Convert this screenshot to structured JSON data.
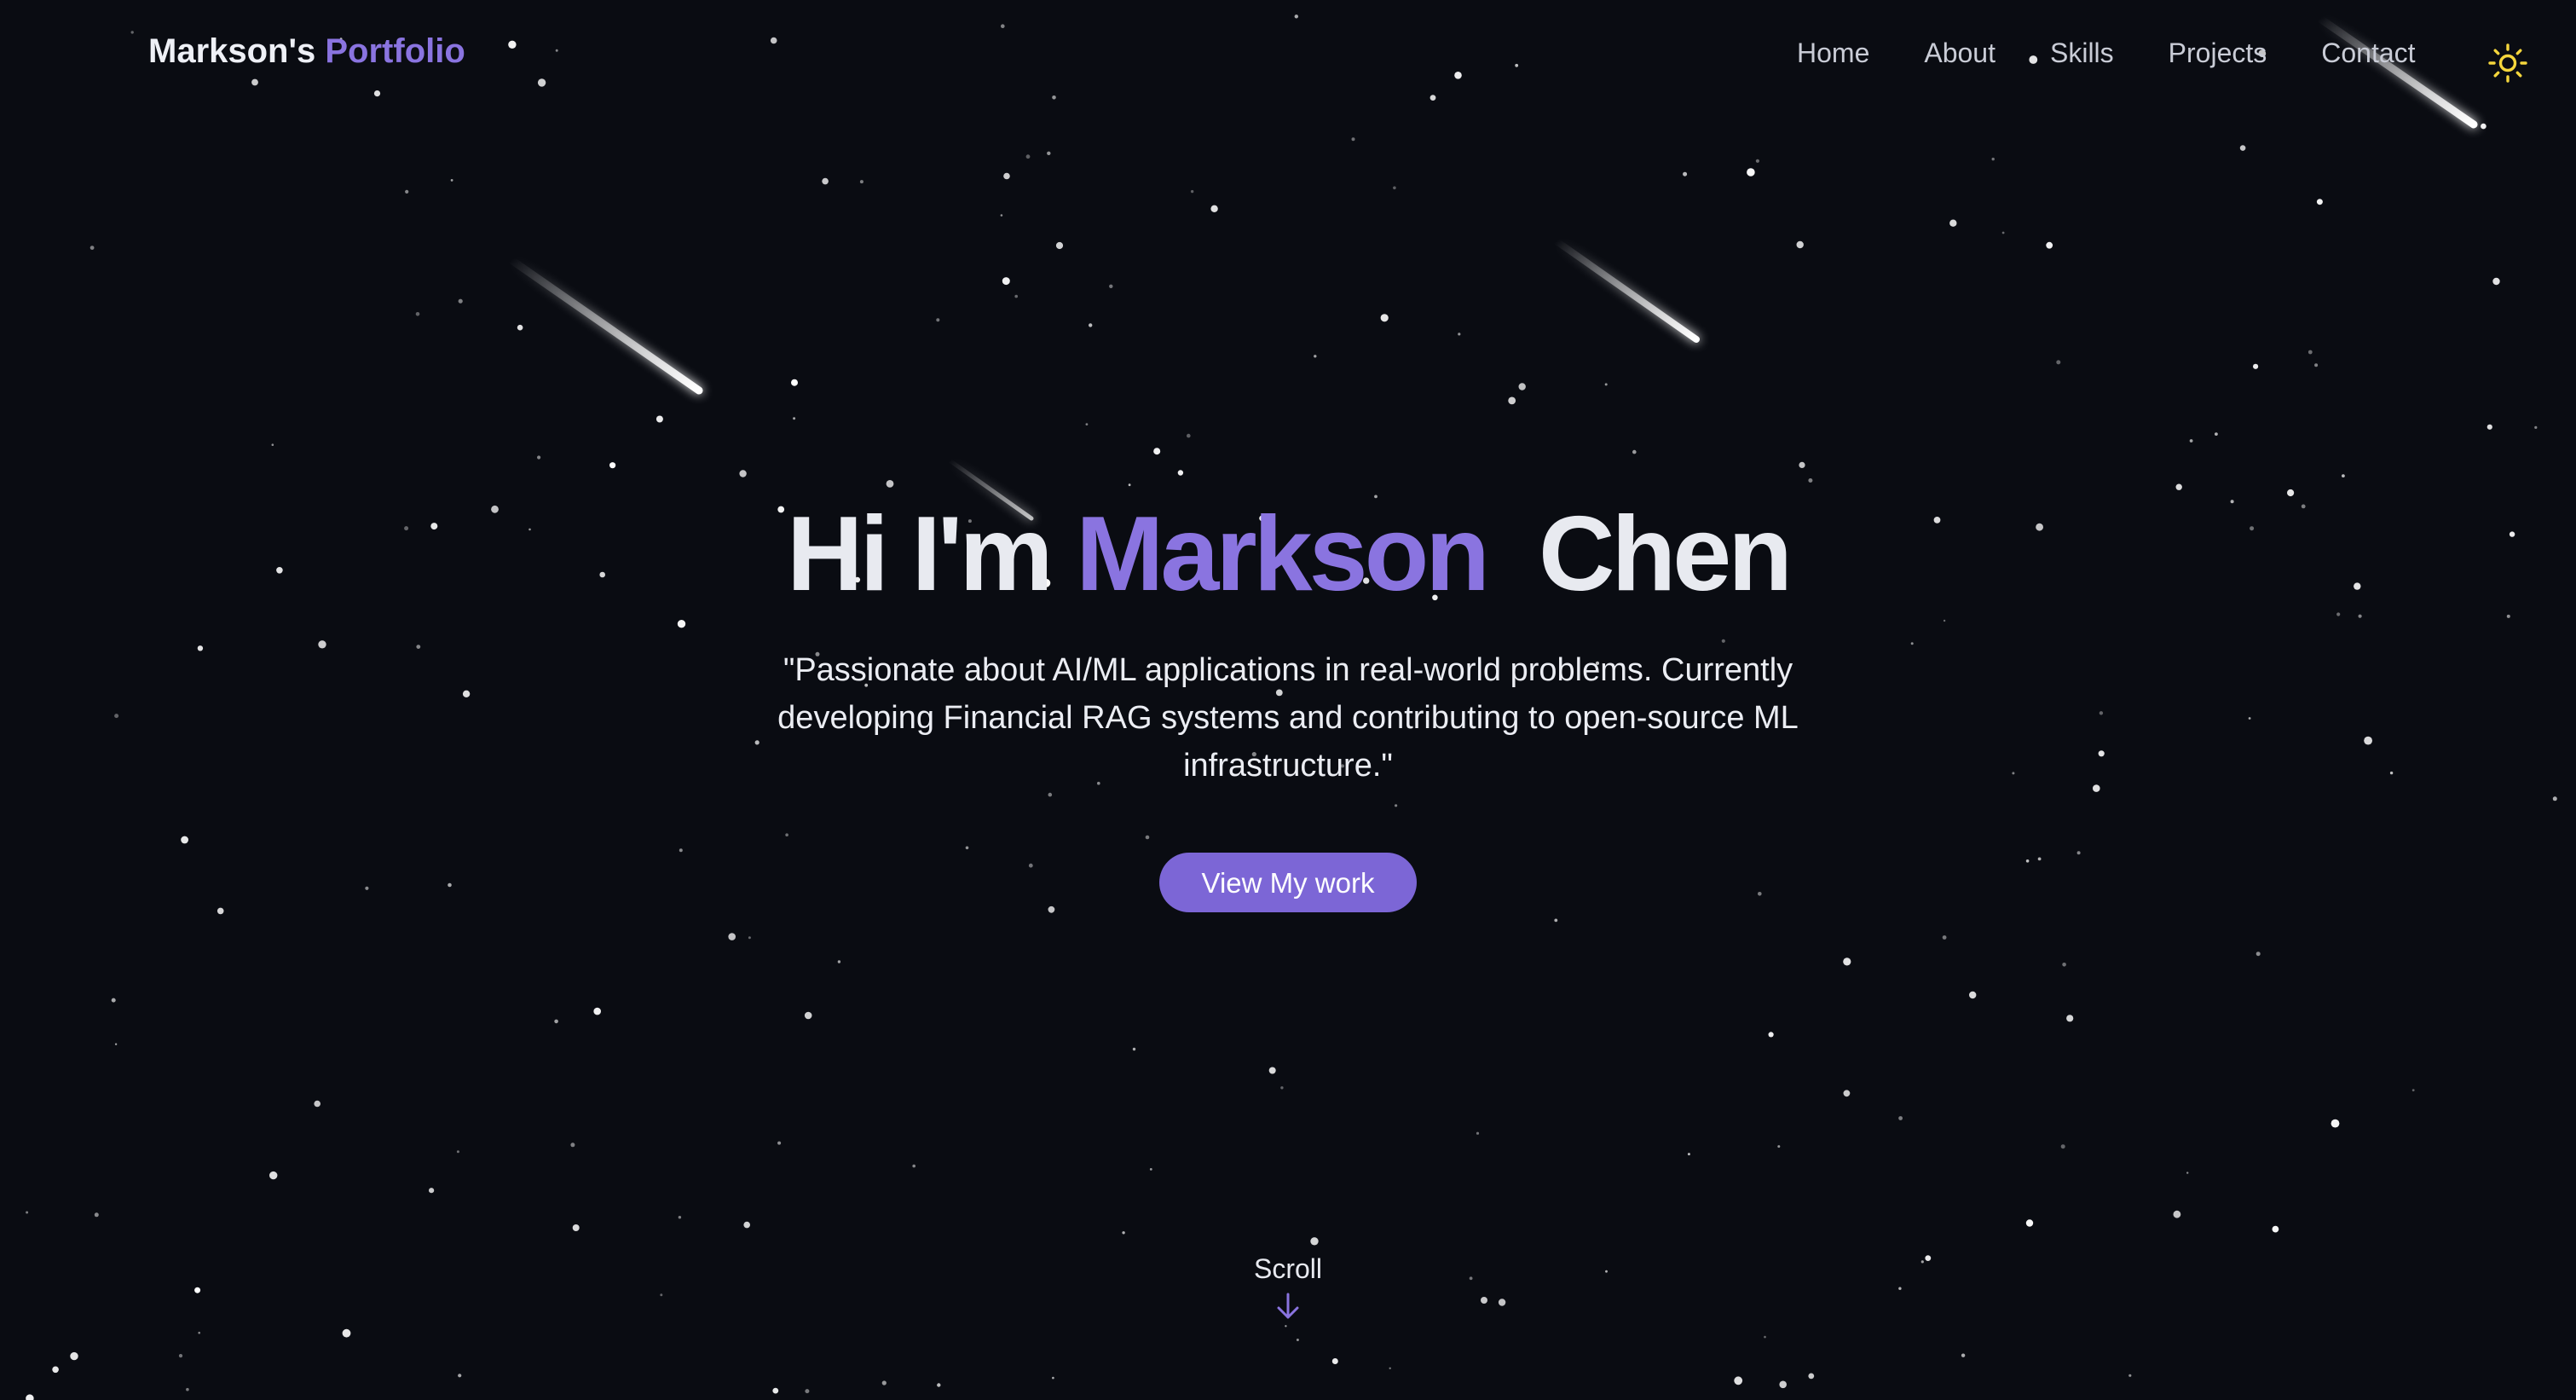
{
  "theme": {
    "background": "#0a0c12",
    "accent": "#8a74e0",
    "button": "#7c66d6",
    "sun_icon_color": "#f5d63c"
  },
  "nav": {
    "brand_prefix": "Markson's",
    "brand_accent": "Portfolio",
    "links": [
      {
        "label": "Home"
      },
      {
        "label": "About"
      },
      {
        "label": "Skills"
      },
      {
        "label": "Projects"
      },
      {
        "label": "Contact"
      }
    ],
    "theme_toggle_icon": "sun-icon"
  },
  "hero": {
    "greeting": "Hi I'm",
    "first_name": "Markson",
    "last_name": "Chen",
    "subtitle": "\"Passionate about AI/ML applications in real-world problems. Currently developing Financial RAG systems and contributing to open-source ML infrastructure.\"",
    "cta_label": "View My work"
  },
  "scroll": {
    "label": "Scroll",
    "icon": "arrow-down-icon"
  }
}
